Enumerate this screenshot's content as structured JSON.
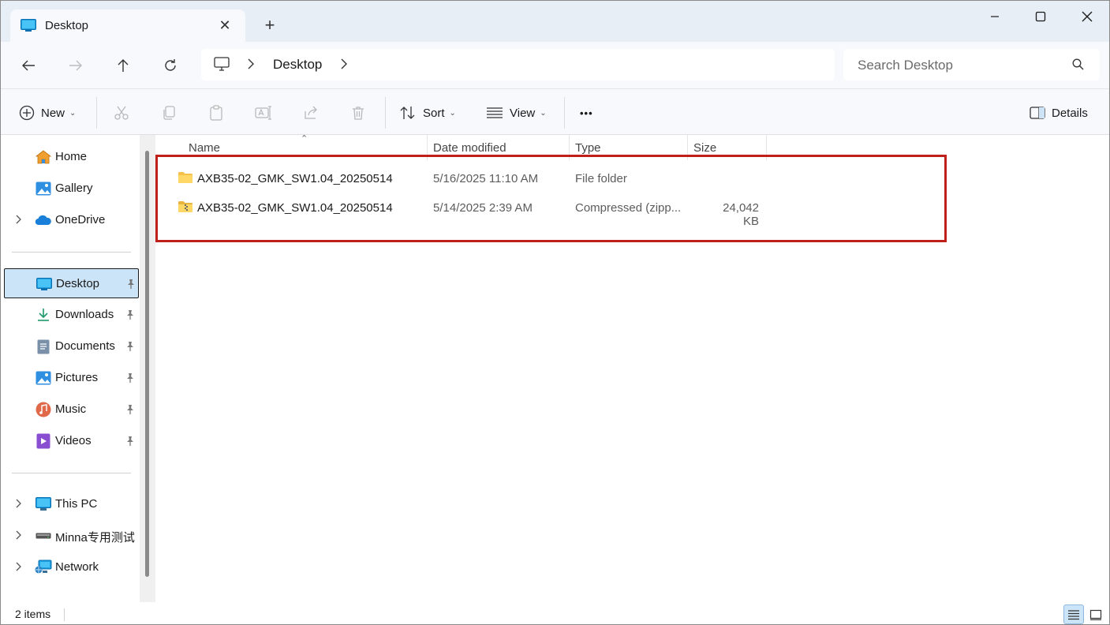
{
  "window": {
    "tab_title": "Desktop",
    "new_tab_glyph": "+"
  },
  "nav": {
    "breadcrumb": "Desktop",
    "search_placeholder": "Search Desktop"
  },
  "commands": {
    "new": "New",
    "sort": "Sort",
    "view": "View",
    "more": "•••",
    "details": "Details"
  },
  "sidebar": {
    "items": [
      {
        "label": "Home",
        "icon": "home-icon"
      },
      {
        "label": "Gallery",
        "icon": "gallery-icon"
      },
      {
        "label": "OneDrive",
        "icon": "onedrive-icon"
      },
      {
        "label": "Desktop",
        "icon": "desktop-icon",
        "selected": true
      },
      {
        "label": "Downloads",
        "icon": "downloads-icon"
      },
      {
        "label": "Documents",
        "icon": "documents-icon"
      },
      {
        "label": "Pictures",
        "icon": "pictures-icon"
      },
      {
        "label": "Music",
        "icon": "music-icon"
      },
      {
        "label": "Videos",
        "icon": "videos-icon"
      },
      {
        "label": "This PC",
        "icon": "this-pc-icon"
      },
      {
        "label": "Minna专用测试",
        "icon": "drive-icon"
      },
      {
        "label": "Network",
        "icon": "network-icon"
      }
    ]
  },
  "table": {
    "columns": [
      "Name",
      "Date modified",
      "Type",
      "Size"
    ],
    "rows": [
      {
        "name": "AXB35-02_GMK_SW1.04_20250514",
        "date": "5/16/2025 11:10 AM",
        "type": "File folder",
        "size": "",
        "icon": "folder-icon"
      },
      {
        "name": "AXB35-02_GMK_SW1.04_20250514",
        "date": "5/14/2025 2:39 AM",
        "type": "Compressed (zipp...",
        "size": "24,042 KB",
        "icon": "zip-folder-icon"
      }
    ]
  },
  "status": {
    "item_count": "2 items"
  },
  "colors": {
    "accent": "#0067c0",
    "selection": "#cce4f7",
    "highlight_box": "#c0201a"
  }
}
